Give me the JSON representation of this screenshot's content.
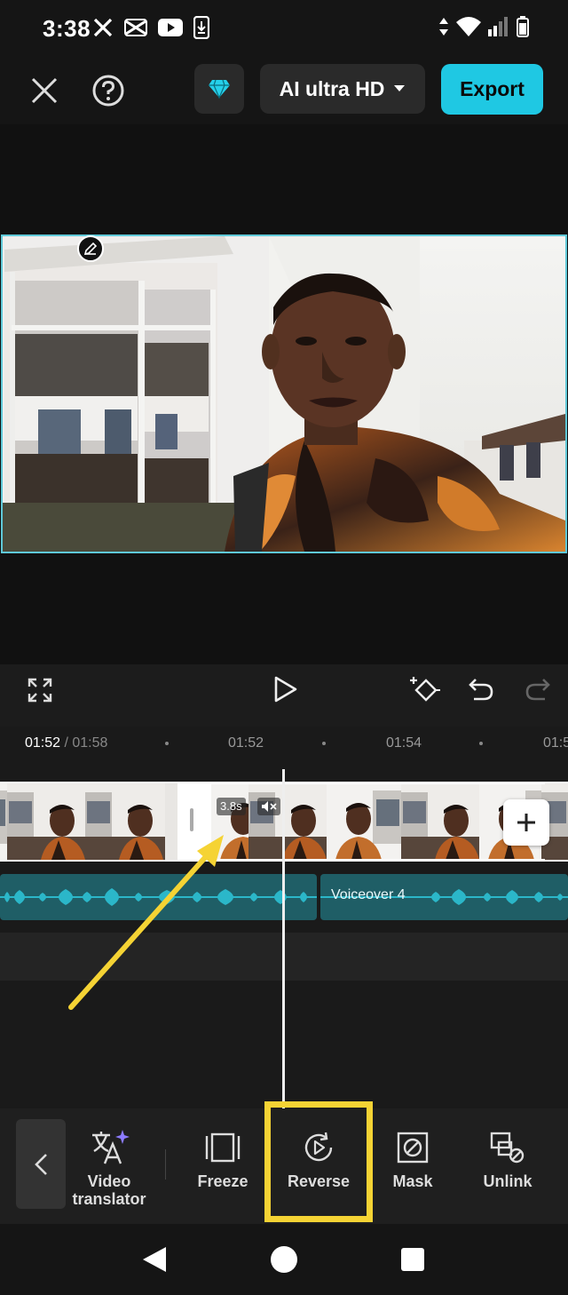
{
  "status_bar": {
    "time": "3:38"
  },
  "top_bar": {
    "quality_label": "AI ultra HD",
    "export_label": "Export"
  },
  "playback": {
    "current_time": "01:52",
    "total_time": " / 01:58",
    "ticks": [
      "01:52",
      "01:54",
      "01:5"
    ]
  },
  "timeline": {
    "clip_duration": "3.8s",
    "voiceover_label": "Voiceover 4"
  },
  "toolbar": {
    "items": [
      {
        "label": "Video\ntranslator",
        "icon": "translate-icon"
      },
      {
        "label": "Freeze",
        "icon": "freeze-icon"
      },
      {
        "label": "Reverse",
        "icon": "reverse-icon"
      },
      {
        "label": "Mask",
        "icon": "mask-icon"
      },
      {
        "label": "Unlink",
        "icon": "unlink-icon"
      }
    ]
  },
  "colors": {
    "accent": "#1fc8e3",
    "highlight": "#f5d334",
    "track": "#1f5e66",
    "background": "#151515"
  }
}
